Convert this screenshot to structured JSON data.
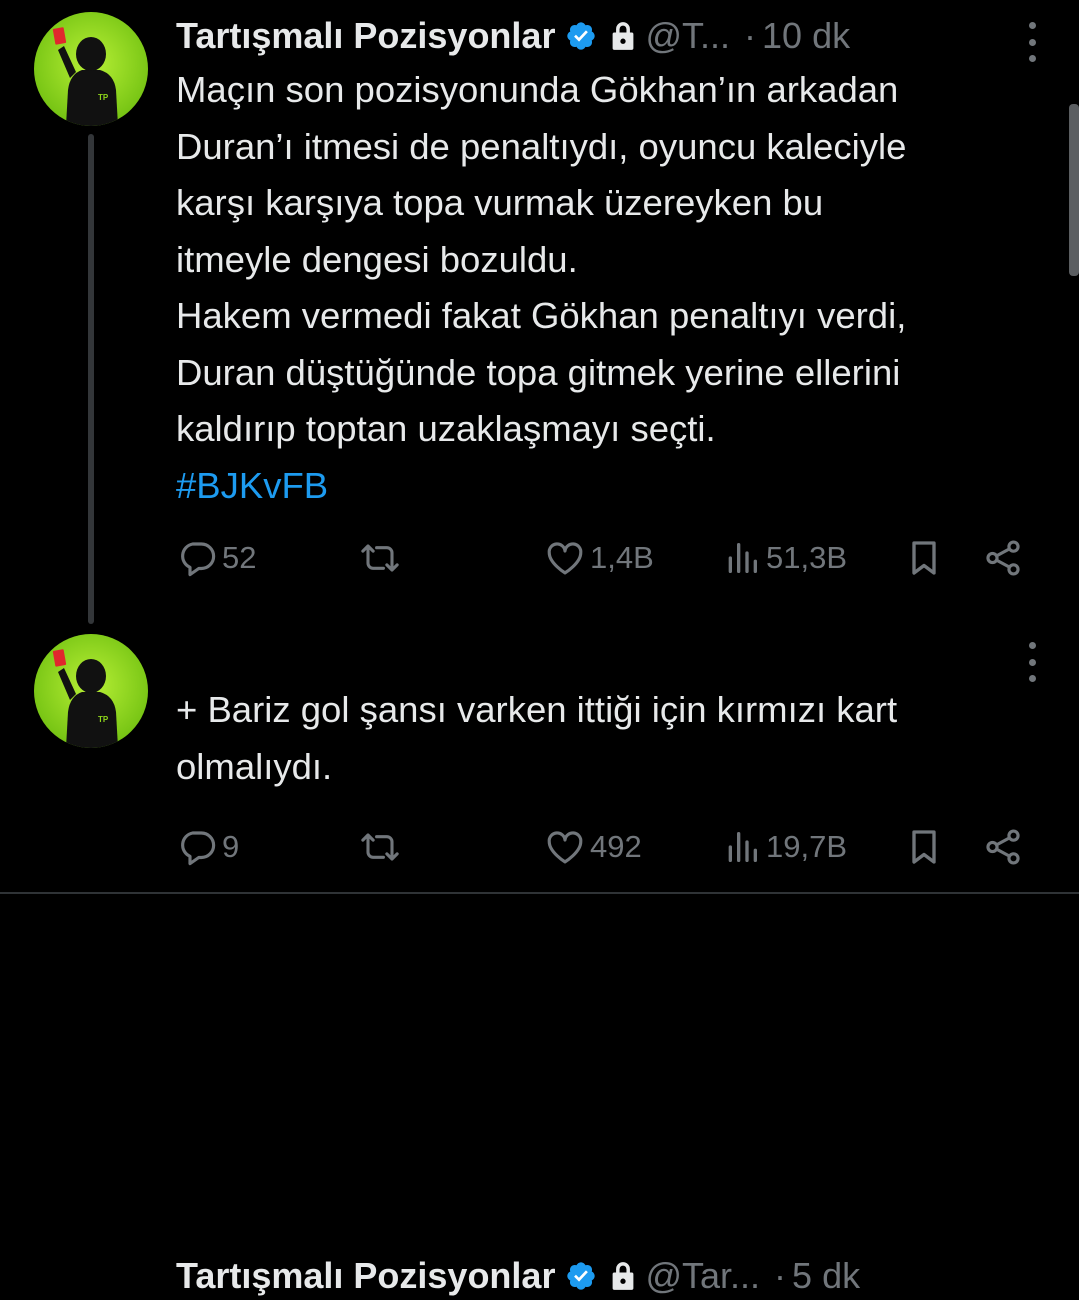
{
  "tweets": [
    {
      "author_name": "Tartışmalı Pozisyonlar",
      "handle": "@T...",
      "separator": "·",
      "time": "10 dk",
      "text": "Maçın son pozisyonunda Gökhan’ın arkadan\nDuran’ı itmesi de penaltıydı, oyuncu kaleciyle\nkarşı karşıya topa vurmak üzereyken bu\nitmeyle dengesi bozuldu.\nHakem vermedi fakat Gökhan penaltıyı verdi,\nDuran düştüğünde topa gitmek yerine ellerini\nkaldırıp toptan uzaklaşmayı seçti.",
      "hashtag": "#BJKvFB",
      "replies": "52",
      "retweets": "",
      "likes": "1,4B",
      "views": "51,3B"
    },
    {
      "author_name": "Tartışmalı Pozisyonlar",
      "handle": "@Tar...",
      "separator": "·",
      "time": "5 dk",
      "text": "+ Bariz gol şansı varken ittiği için kırmızı kart\nolmalıydı.",
      "hashtag": "",
      "replies": "9",
      "retweets": "",
      "likes": "492",
      "views": "19,7B"
    }
  ],
  "avatar_text": "TP",
  "colors": {
    "background": "#000000",
    "text": "#e7e9ea",
    "muted": "#71767b",
    "link": "#1d9bf0",
    "verified": "#1d9bf0",
    "avatar_green": "#8ed61a"
  },
  "icons": [
    "verified-badge-icon",
    "lock-icon",
    "more-icon",
    "reply-icon",
    "retweet-icon",
    "like-icon",
    "views-icon",
    "bookmark-icon",
    "share-icon"
  ]
}
